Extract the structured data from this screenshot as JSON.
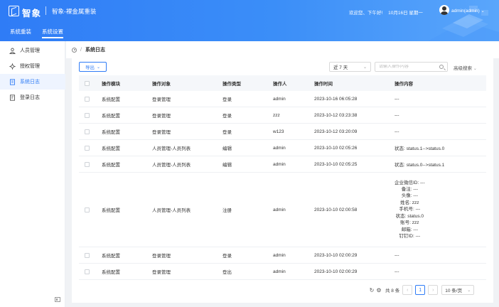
{
  "header": {
    "logo_text": "智象",
    "app_title": "智象-裸金属重装",
    "welcome": "欢迎您、下午好!",
    "date": "10月16日 星期一",
    "user": "admin(admin)"
  },
  "nav_tabs": [
    {
      "label": "系统重装",
      "active": false
    },
    {
      "label": "系统设置",
      "active": true
    }
  ],
  "sidebar": {
    "items": [
      {
        "label": "人员管理",
        "icon": "user-icon",
        "active": false
      },
      {
        "label": "授权管理",
        "icon": "authorization-icon",
        "active": false
      },
      {
        "label": "系统日志",
        "icon": "document-icon",
        "active": true
      },
      {
        "label": "登录日志",
        "icon": "login-log-icon",
        "active": false
      }
    ]
  },
  "breadcrumb": {
    "current": "系统日志"
  },
  "toolbar": {
    "export_label": "导出",
    "period_value": "近 7 天",
    "search_placeholder": "请输入操作内容",
    "advanced_search": "高级搜索"
  },
  "table": {
    "columns": [
      "操作模块",
      "操作对象",
      "操作类型",
      "操作人",
      "操作时间",
      "操作内容"
    ],
    "rows": [
      {
        "module": "系统配置",
        "object": "登录管理",
        "type": "登录",
        "operator": "admin",
        "time": "2023-10-16 06:05:28",
        "content": [
          "---"
        ]
      },
      {
        "module": "系统配置",
        "object": "登录管理",
        "type": "登录",
        "operator": "zzz",
        "time": "2023-10-12 03:23:38",
        "content": [
          "---"
        ]
      },
      {
        "module": "系统配置",
        "object": "登录管理",
        "type": "登录",
        "operator": "w123",
        "time": "2023-10-12 03:20:09",
        "content": [
          "---"
        ]
      },
      {
        "module": "系统配置",
        "object": "人员管理-人员列表",
        "type": "编辑",
        "operator": "admin",
        "time": "2023-10-10 02:05:26",
        "content": [
          "状态: status.1-->status.0"
        ]
      },
      {
        "module": "系统配置",
        "object": "人员管理-人员列表",
        "type": "编辑",
        "operator": "admin",
        "time": "2023-10-10 02:05:25",
        "content": [
          "状态: status.0-->status.1"
        ]
      },
      {
        "module": "系统配置",
        "object": "人员管理-人员列表",
        "type": "注册",
        "operator": "admin",
        "time": "2023-10-10 02:00:58",
        "content": [
          "企业微信ID: ---",
          "备注: ---",
          "头像: ---",
          "姓名: zzz",
          "手机号: ---",
          "状态: status.0",
          "账号: zzz",
          "邮箱: ---",
          "钉钉ID: ---"
        ]
      },
      {
        "module": "系统配置",
        "object": "登录管理",
        "type": "登录",
        "operator": "admin",
        "time": "2023-10-10 02:00:29",
        "content": [
          "---"
        ]
      },
      {
        "module": "系统配置",
        "object": "登录管理",
        "type": "登出",
        "operator": "admin",
        "time": "2023-10-10 02:00:29",
        "content": [
          "---"
        ]
      }
    ]
  },
  "pagination": {
    "total": "共 8 条",
    "current_page": "1",
    "page_size": "10 条/页"
  }
}
